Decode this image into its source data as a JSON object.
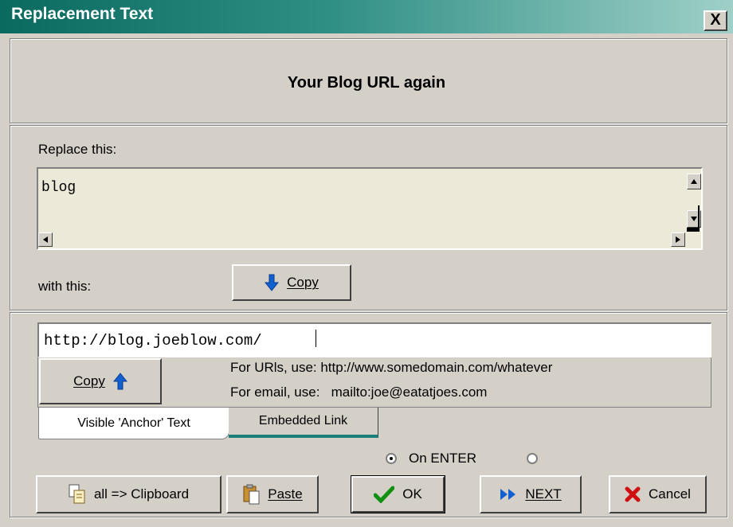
{
  "window": {
    "title": "Replacement Text",
    "close_label": "X"
  },
  "header": {
    "title": "Your Blog URL again"
  },
  "replace": {
    "label": "Replace this:",
    "value": "blog"
  },
  "with": {
    "label": "with this:",
    "copy_down_label": "Copy",
    "url_value": "http://blog.joeblow.com/",
    "copy_up_label": "Copy",
    "hint_urls": "For URls, use: http://www.somedomain.com/whatever",
    "hint_email": "For email, use:   mailto:joe@eatatjoes.com"
  },
  "tabs": [
    {
      "label": "Visible 'Anchor' Text",
      "selected": true
    },
    {
      "label": "Embedded Link",
      "selected": false
    }
  ],
  "options": {
    "on_enter_label": "On ENTER",
    "on_enter_checked": true,
    "other_checked": false
  },
  "buttons": {
    "clipboard": "all => Clipboard",
    "paste": "Paste",
    "ok": "OK",
    "next": "NEXT",
    "cancel": "Cancel"
  },
  "colors": {
    "titlebar_start": "#0a6a60",
    "titlebar_end": "#9fd0c8",
    "arrow_blue": "#1060d0",
    "ok_green": "#109010",
    "cancel_red": "#d01010",
    "tab_accent": "#1a7f7a"
  },
  "icons": {
    "copy_down": "arrow-down-icon",
    "copy_up": "arrow-up-icon",
    "clipboard": "clipboard-icon",
    "paste": "paste-icon",
    "ok": "checkmark-icon",
    "next": "fast-forward-icon",
    "cancel": "x-icon"
  }
}
